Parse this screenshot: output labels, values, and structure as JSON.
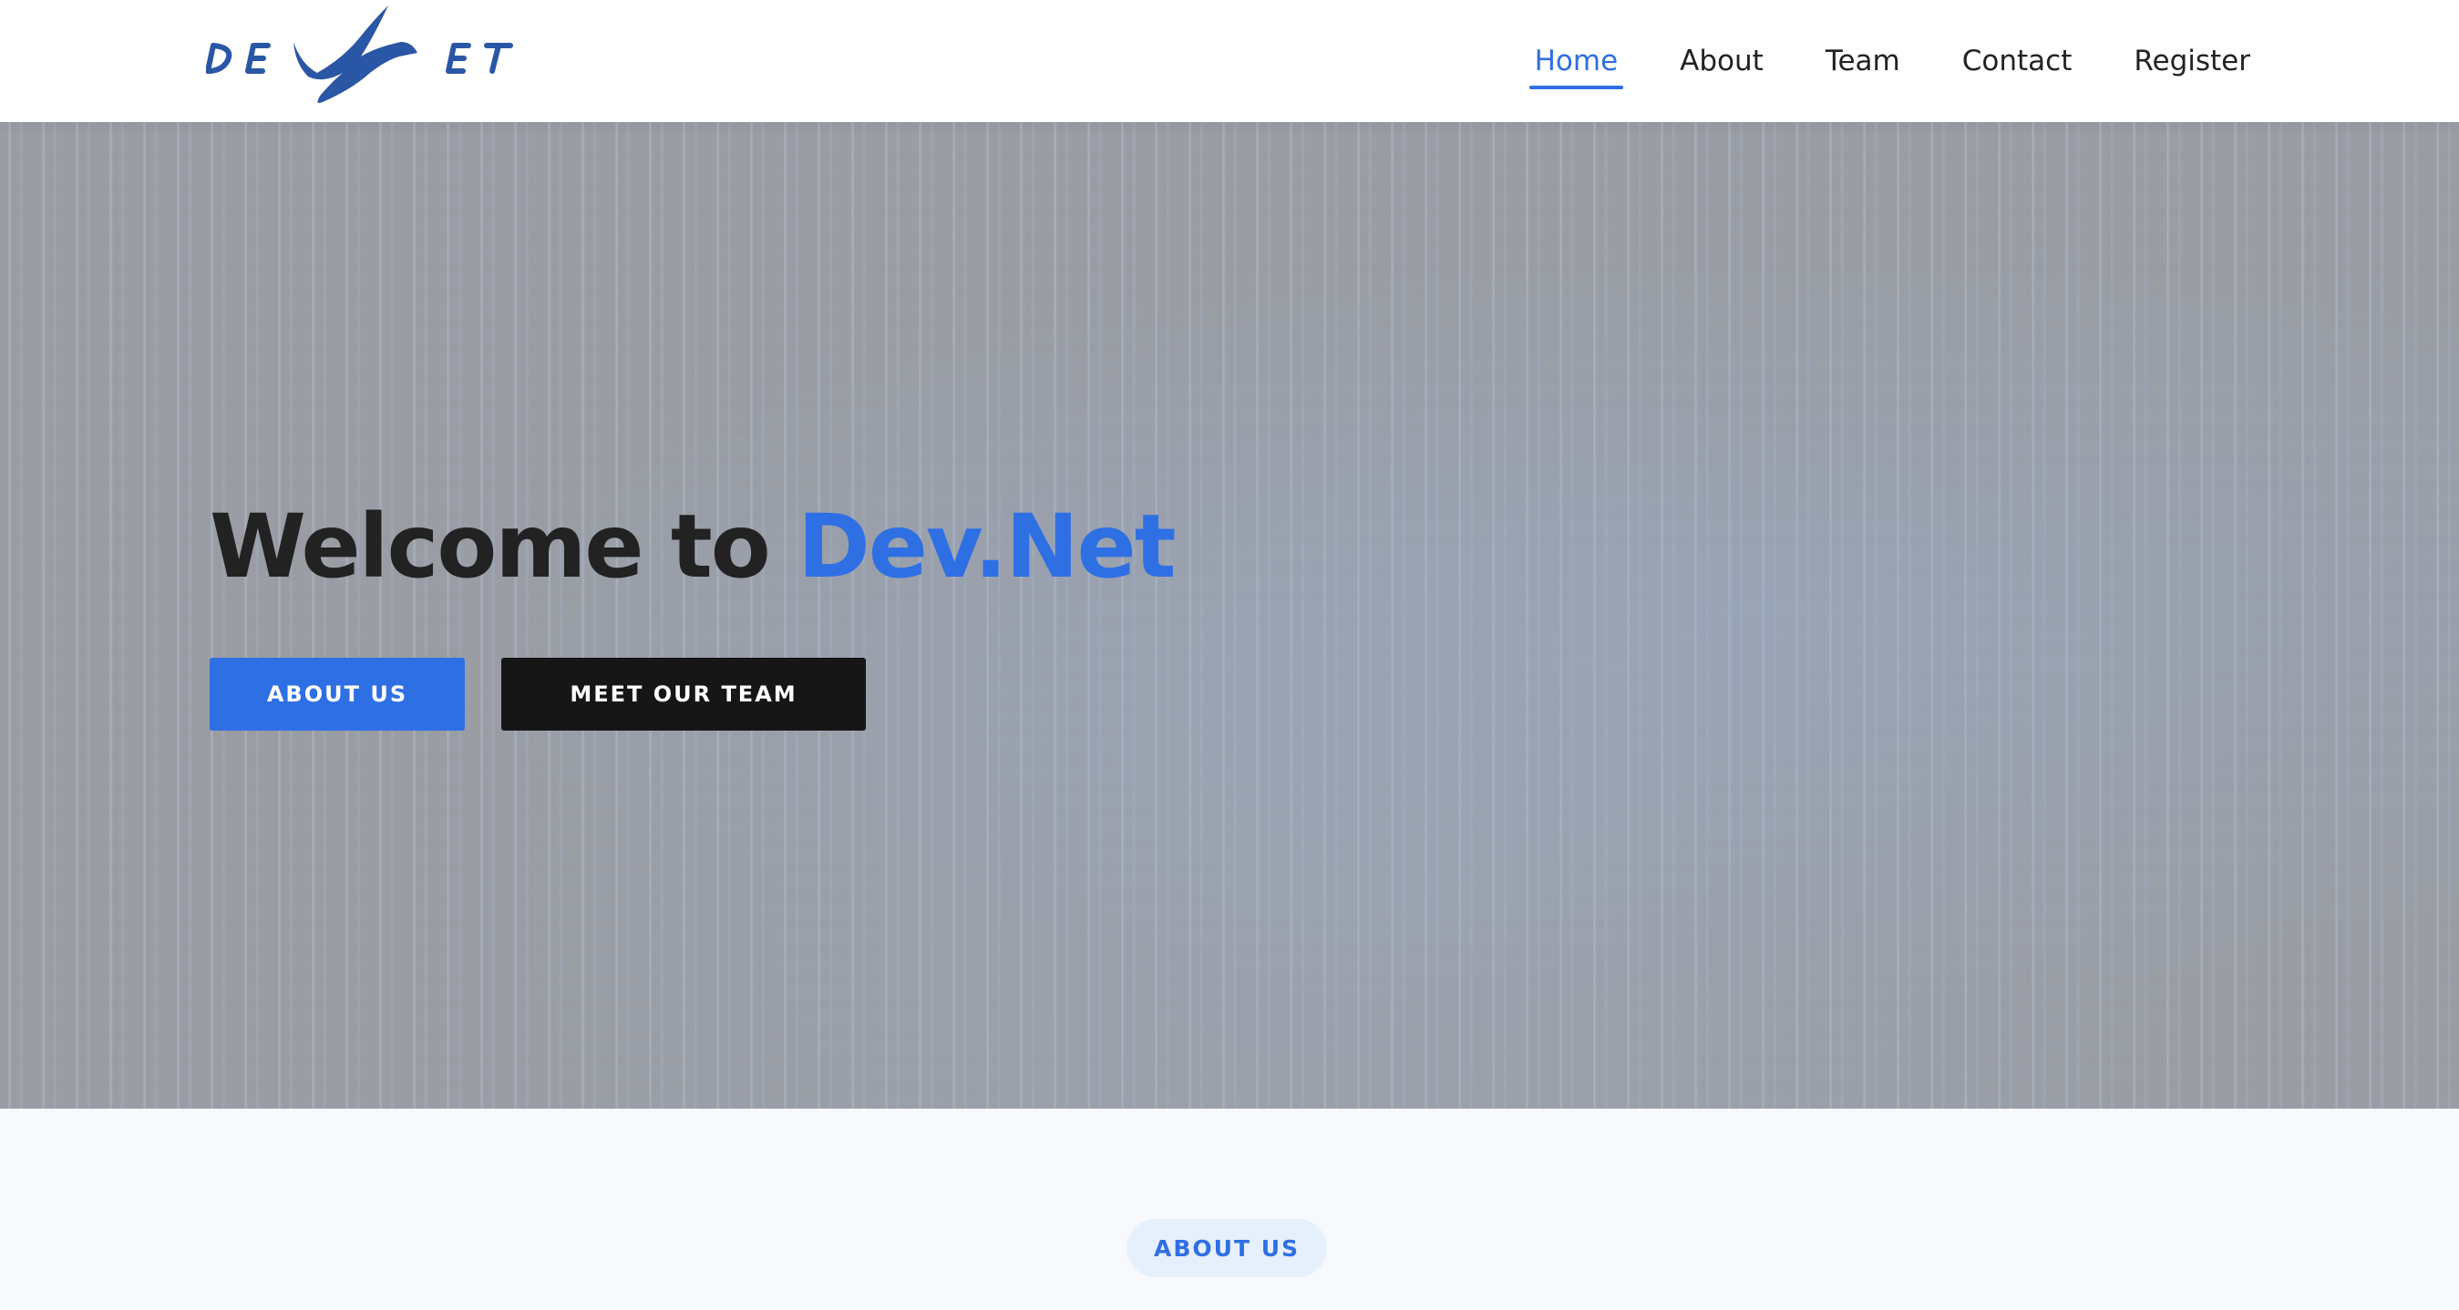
{
  "brand": {
    "logo_text": "DEVNET",
    "accent_color": "#2f6fe4",
    "logo_color": "#2a56a6"
  },
  "nav": {
    "items": [
      {
        "label": "Home",
        "active": true
      },
      {
        "label": "About",
        "active": false
      },
      {
        "label": "Team",
        "active": false
      },
      {
        "label": "Contact",
        "active": false
      },
      {
        "label": "Register",
        "active": false
      }
    ]
  },
  "hero": {
    "title_prefix": "Welcome to ",
    "title_accent": "Dev.Net",
    "buttons": {
      "about": "ABOUT US",
      "team": "MEET OUR TEAM"
    }
  },
  "about_section": {
    "pill": "ABOUT US"
  }
}
